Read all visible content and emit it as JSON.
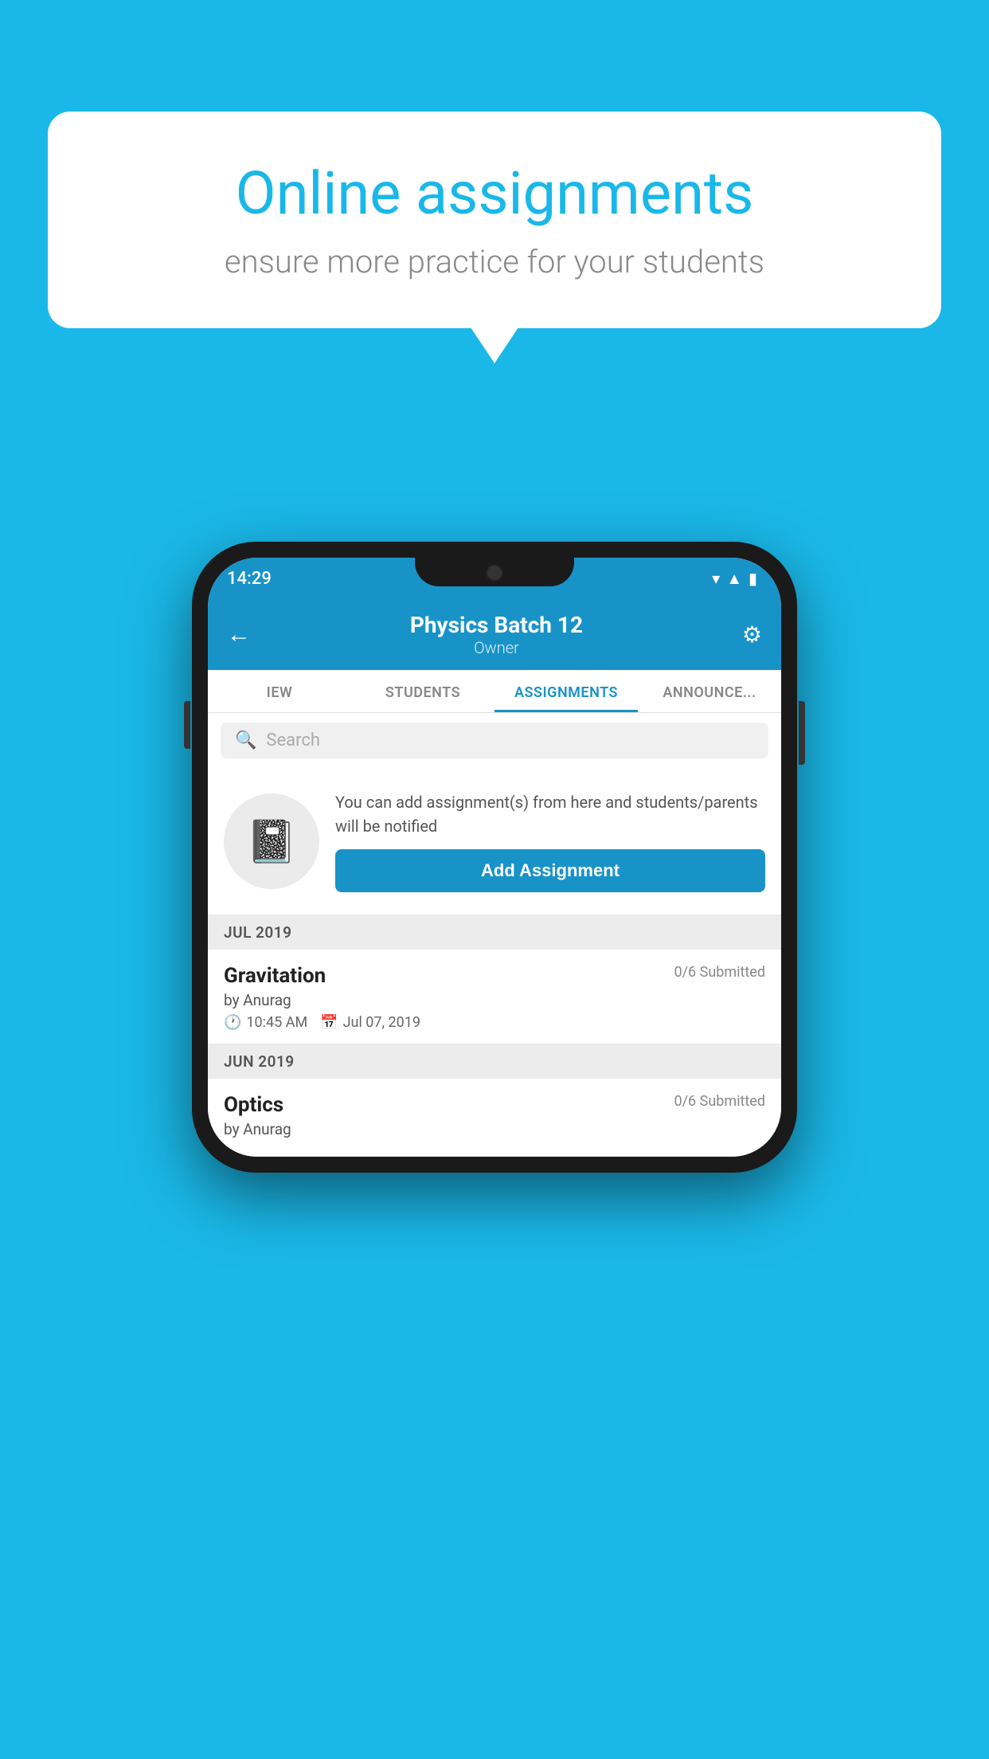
{
  "background_color": "#1ab8e8",
  "speech_bubble": {
    "title": "Online assignments",
    "subtitle": "ensure more practice for your students"
  },
  "phone": {
    "status_bar": {
      "time": "14:29",
      "icons": [
        "wifi",
        "signal",
        "battery"
      ]
    },
    "header": {
      "title": "Physics Batch 12",
      "subtitle": "Owner",
      "back_label": "←",
      "settings_label": "⚙"
    },
    "tabs": [
      {
        "label": "IEW",
        "active": false
      },
      {
        "label": "STUDENTS",
        "active": false
      },
      {
        "label": "ASSIGNMENTS",
        "active": true
      },
      {
        "label": "ANNOUNCEMENTS",
        "active": false
      }
    ],
    "search": {
      "placeholder": "Search"
    },
    "promo": {
      "icon": "📓",
      "text": "You can add assignment(s) from here and students/parents will be notified",
      "button_label": "Add Assignment"
    },
    "sections": [
      {
        "label": "JUL 2019",
        "assignments": [
          {
            "title": "Gravitation",
            "submitted": "0/6 Submitted",
            "by": "by Anurag",
            "time": "10:45 AM",
            "date": "Jul 07, 2019"
          }
        ]
      },
      {
        "label": "JUN 2019",
        "assignments": [
          {
            "title": "Optics",
            "submitted": "0/6 Submitted",
            "by": "by Anurag",
            "time": "",
            "date": ""
          }
        ]
      }
    ]
  }
}
